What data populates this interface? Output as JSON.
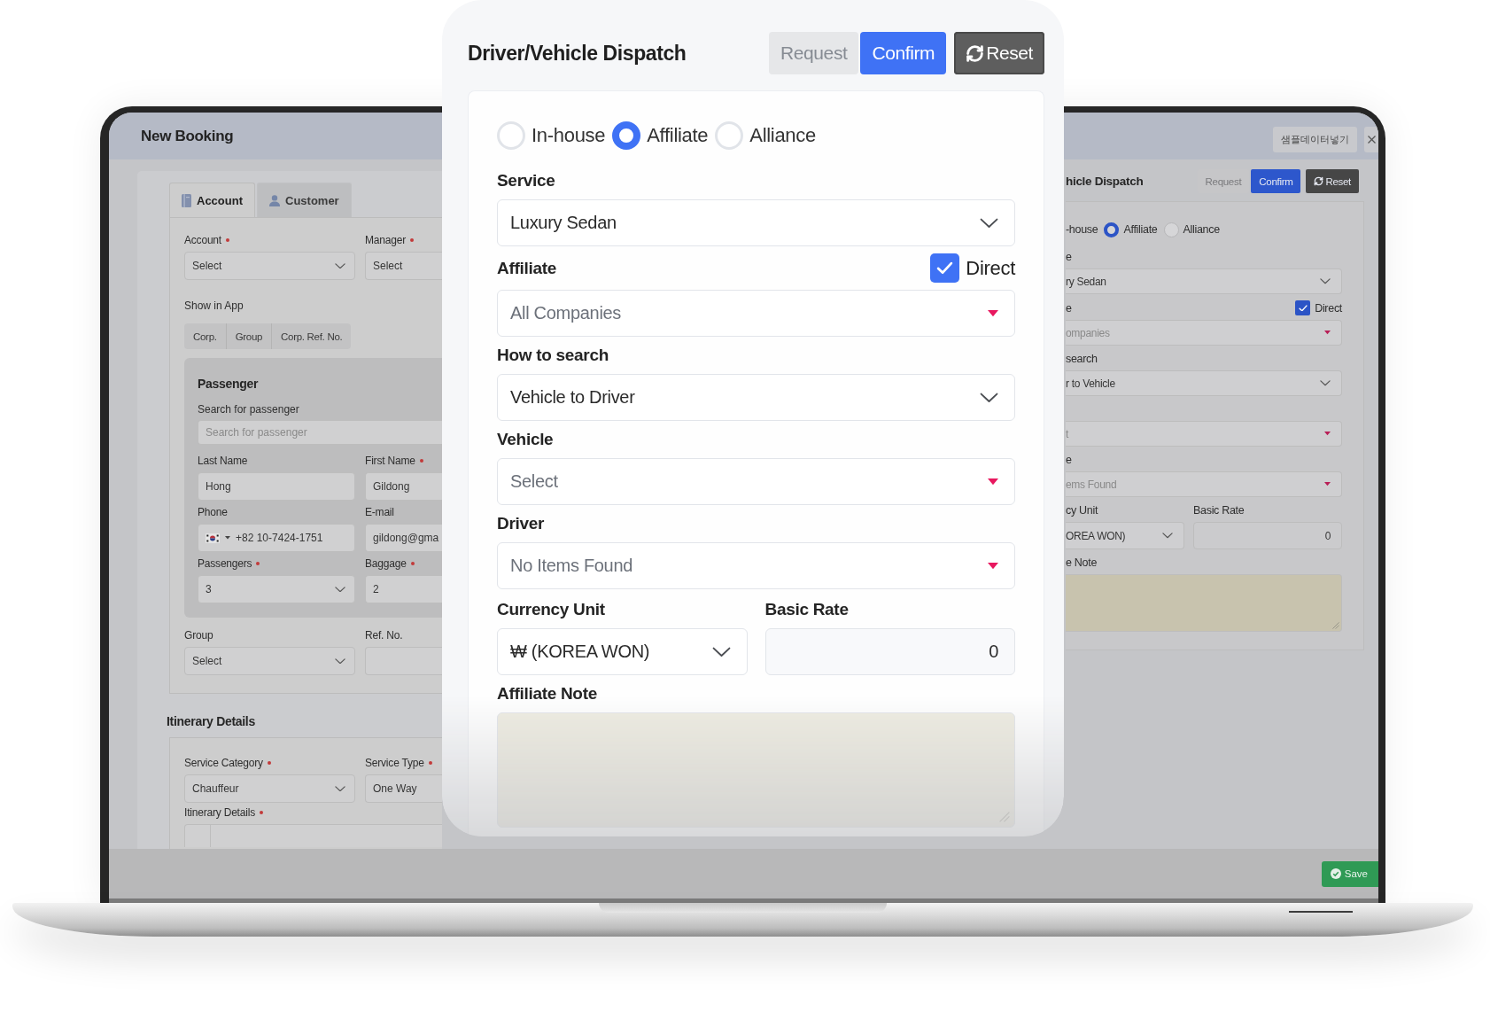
{
  "laptop_app": {
    "header": {
      "title": "New Booking",
      "sample_data_button": "샘플데이터넣기"
    },
    "account_tabs": [
      {
        "label": "Account",
        "selected": true
      },
      {
        "label": "Customer",
        "selected": false
      }
    ],
    "account_fields": [
      {
        "label": "Account",
        "required": true,
        "value": "Select",
        "kind": "select"
      },
      {
        "label": "Manager",
        "required": true,
        "value": "Select"
      }
    ],
    "show_in_app": {
      "label": "Show in App",
      "options": [
        "Corp.",
        "Group",
        "Corp. Ref. No."
      ]
    },
    "passenger": {
      "title": "Passenger",
      "search": {
        "label": "Search for passenger",
        "placeholder": "Search for passenger"
      },
      "field_rows": [
        [
          {
            "label": "Last Name",
            "required": false,
            "value": "Hong",
            "kind": "input"
          },
          {
            "label": "First Name",
            "required": true,
            "value": "Gildong"
          }
        ],
        [
          {
            "label": "Phone",
            "required": false,
            "value": "+82 10-7424-1751",
            "kind": "phone"
          },
          {
            "label": "E-mail",
            "required": false,
            "value": "gildong@gma"
          }
        ],
        [
          {
            "label": "Passengers",
            "required": true,
            "value": "3",
            "kind": "select"
          },
          {
            "label": "Baggage",
            "required": true,
            "value": "2"
          }
        ]
      ]
    },
    "group_fields": [
      {
        "label": "Group",
        "required": false,
        "value": "Select",
        "kind": "select"
      },
      {
        "label": "Ref. No.",
        "required": false
      }
    ],
    "itinerary": {
      "title": "Itinerary Details",
      "fields": [
        {
          "label": "Service Category",
          "required": true,
          "value": "Chauffeur",
          "kind": "select"
        },
        {
          "label": "Service Type",
          "required": true,
          "value": "One Way"
        }
      ],
      "details": {
        "label": "Itinerary Details",
        "required": true
      }
    },
    "dispatch_panel": {
      "title": "hicle Dispatch",
      "buttons": [
        {
          "label": "Request",
          "kind": "primary",
          "disabled": true
        },
        {
          "label": "Confirm",
          "kind": "primary",
          "disabled": false
        },
        {
          "label": "Reset",
          "kind": "reset",
          "disabled": false
        }
      ],
      "cut_option": "-house",
      "dispatch_types": [
        {
          "label": "Affiliate",
          "selected": true
        },
        {
          "label": "Alliance",
          "selected": false
        }
      ],
      "fields": [
        {
          "label": "e",
          "value": "ry Sedan",
          "kind": "select"
        },
        {
          "label": "e",
          "placeholder": "ompanies",
          "kind": "picker",
          "direct": {
            "label": "Direct",
            "checked": true
          }
        },
        {
          "label": "search",
          "value": "r to Vehicle",
          "kind": "select"
        },
        {
          "placeholder": "t",
          "kind": "picker"
        },
        {
          "label": "e",
          "placeholder": "ems Found",
          "kind": "picker"
        }
      ],
      "pricing": [
        {
          "label": "cy Unit",
          "value": "OREA WON)",
          "kind": "select"
        },
        {
          "label": "Basic Rate",
          "value": "0",
          "kind": "number"
        }
      ],
      "note": {
        "label": "e Note"
      }
    },
    "save_button": "Save"
  },
  "dispatch_card": {
    "title": "Driver/Vehicle Dispatch",
    "buttons": [
      {
        "label": "Request",
        "kind": "primary",
        "disabled": true
      },
      {
        "label": "Confirm",
        "kind": "primary",
        "disabled": false
      },
      {
        "label": "Reset",
        "kind": "reset",
        "disabled": false
      }
    ],
    "dispatch_types": [
      {
        "label": "In-house",
        "selected": false
      },
      {
        "label": "Affiliate",
        "selected": true
      },
      {
        "label": "Alliance",
        "selected": false
      }
    ],
    "fields": [
      {
        "label": "Service",
        "value": "Luxury Sedan",
        "kind": "select"
      },
      {
        "label": "Affiliate",
        "placeholder": "All Companies",
        "kind": "picker",
        "direct": {
          "label": "Direct",
          "checked": true
        }
      },
      {
        "label": "How to search",
        "value": "Vehicle to Driver",
        "kind": "select"
      },
      {
        "label": "Vehicle",
        "placeholder": "Select",
        "kind": "picker"
      },
      {
        "label": "Driver",
        "placeholder": "No Items Found",
        "kind": "picker"
      }
    ],
    "pricing": [
      {
        "label": "Currency Unit",
        "value": "₩ (KOREA WON)",
        "kind": "select"
      },
      {
        "label": "Basic Rate",
        "value": "0",
        "kind": "number"
      }
    ],
    "note": {
      "label": "Affiliate Note"
    }
  }
}
